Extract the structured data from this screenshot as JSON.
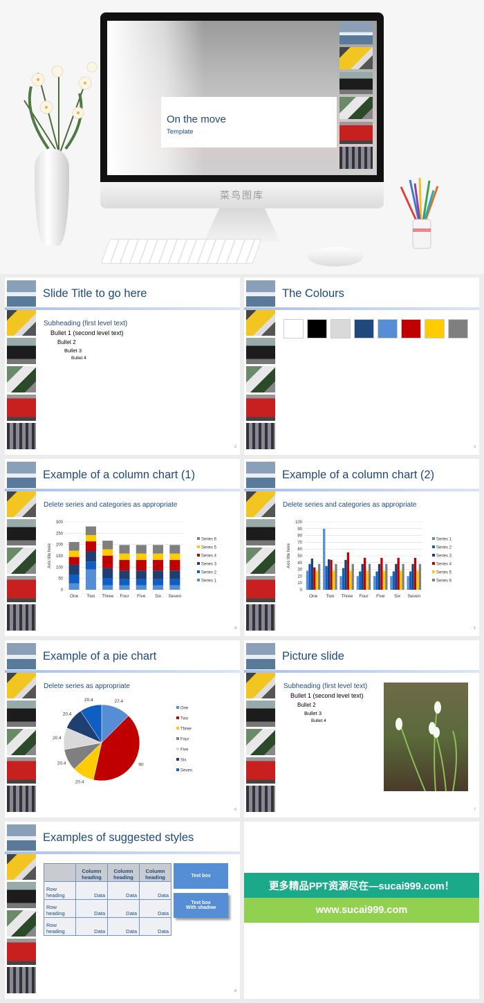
{
  "hero": {
    "screen_title": "On the move",
    "screen_subtitle": "Template",
    "watermark": "菜鸟图库"
  },
  "colors": {
    "title": "#1f497d",
    "accent_rule": "#a8c0e8"
  },
  "thumbnails": [
    "boat",
    "tram",
    "taxi",
    "motorcycle",
    "bus",
    "people"
  ],
  "slides": [
    {
      "title": "Slide Title to go here",
      "subheading": "Subheading (first level text)",
      "bullets": [
        "Bullet 1 (second level text)",
        "Bullet 2",
        "Bullet 3",
        "Bullet 4"
      ],
      "page": "2"
    },
    {
      "title": "The Colours",
      "swatches": [
        "#ffffff",
        "#000000",
        "#d9d9d9",
        "#1f497d",
        "#558ed5",
        "#c00000",
        "#ffcc00",
        "#7f7f7f"
      ],
      "page": "3"
    },
    {
      "title": "Example of a column chart (1)",
      "subheading": "Delete series and categories as appropriate",
      "page": "4"
    },
    {
      "title": "Example of a column chart (2)",
      "subheading": "Delete series and categories as appropriate",
      "page": "5"
    },
    {
      "title": "Example of a pie chart",
      "subheading": "Delete series as appropriate",
      "page": "6"
    },
    {
      "title": "Picture slide",
      "subheading": "Subheading (first level text)",
      "bullets": [
        "Bullet 1 (second level text)",
        "Bullet 2",
        "Bullet 3",
        "Bullet 4"
      ],
      "page": "7"
    },
    {
      "title": "Examples of suggested styles",
      "table": {
        "headers": [
          "",
          "Column heading",
          "Column heading",
          "Column heading"
        ],
        "rows": [
          [
            "Row heading",
            "Data",
            "Data",
            "Data"
          ],
          [
            "Row heading",
            "Data",
            "Data",
            "Data"
          ],
          [
            "Row heading",
            "Data",
            "Data",
            "Data"
          ]
        ]
      },
      "text_box": "Text box",
      "text_box_shadow": [
        "Text box",
        "With shadow"
      ],
      "page": "8"
    },
    {
      "banner_line1": "更多精品PPT资源尽在—sucai999.com！",
      "banner_line2": "www.sucai999.com",
      "banner_colors": [
        "#1aaa8a",
        "#92d050"
      ]
    }
  ],
  "chart_data": [
    {
      "type": "bar",
      "stacked": true,
      "categories": [
        "One",
        "Two",
        "Three",
        "Four",
        "Five",
        "Six",
        "Seven"
      ],
      "ylabel": "Axis title here",
      "ylim": [
        0,
        300
      ],
      "yticks": [
        0,
        50,
        100,
        150,
        200,
        250,
        300
      ],
      "grid": true,
      "legend": "right",
      "series": [
        {
          "name": "Series 1",
          "color": "#558ed5",
          "values": [
            28,
            90,
            20,
            20,
            20,
            20,
            20
          ]
        },
        {
          "name": "Series 2",
          "color": "#0f5fc2",
          "values": [
            38,
            35,
            32,
            27,
            27,
            27,
            27
          ]
        },
        {
          "name": "Series 3",
          "color": "#1f3f73",
          "values": [
            46,
            45,
            44,
            38,
            38,
            38,
            38
          ]
        },
        {
          "name": "Series 4",
          "color": "#c00000",
          "values": [
            33,
            44,
            55,
            47,
            47,
            47,
            47
          ]
        },
        {
          "name": "Series 5",
          "color": "#ffcc00",
          "values": [
            28,
            28,
            28,
            28,
            28,
            28,
            28
          ]
        },
        {
          "name": "Series 6",
          "color": "#7f7f7f",
          "values": [
            38,
            38,
            38,
            38,
            38,
            38,
            38
          ]
        }
      ]
    },
    {
      "type": "bar",
      "stacked": false,
      "categories": [
        "One",
        "Two",
        "Three",
        "Four",
        "Five",
        "Six",
        "Seven"
      ],
      "ylabel": "Axis title here",
      "ylim": [
        0,
        100
      ],
      "yticks": [
        0,
        10,
        20,
        30,
        40,
        50,
        60,
        70,
        80,
        90,
        100
      ],
      "grid": true,
      "legend": "right",
      "series": [
        {
          "name": "Series 1",
          "color": "#558ed5",
          "values": [
            28,
            90,
            20,
            20,
            20,
            20,
            20
          ]
        },
        {
          "name": "Series 2",
          "color": "#0f5fc2",
          "values": [
            38,
            35,
            32,
            27,
            27,
            27,
            27
          ]
        },
        {
          "name": "Series 3",
          "color": "#1f3f73",
          "values": [
            46,
            45,
            44,
            38,
            38,
            38,
            38
          ]
        },
        {
          "name": "Series 4",
          "color": "#c00000",
          "values": [
            33,
            44,
            55,
            47,
            47,
            47,
            47
          ]
        },
        {
          "name": "Series 5",
          "color": "#ffcc00",
          "values": [
            28,
            28,
            28,
            28,
            28,
            28,
            28
          ]
        },
        {
          "name": "Series 6",
          "color": "#7f7f7f",
          "values": [
            38,
            38,
            38,
            38,
            38,
            38,
            38
          ]
        }
      ]
    },
    {
      "type": "pie",
      "legend": "right",
      "categories": [
        "One",
        "Two",
        "Three",
        "Four",
        "Five",
        "Six",
        "Seven"
      ],
      "values": [
        27.4,
        90,
        20.4,
        20.4,
        20.4,
        20.4,
        20.4
      ],
      "labels": [
        "27.4",
        "90",
        "20.4",
        "20.4",
        "20.4",
        "20.4",
        "20.4"
      ],
      "colors": [
        "#558ed5",
        "#c00000",
        "#ffcc00",
        "#7f7f7f",
        "#d9d9d9",
        "#1f3f73",
        "#0f5fc2"
      ]
    }
  ]
}
